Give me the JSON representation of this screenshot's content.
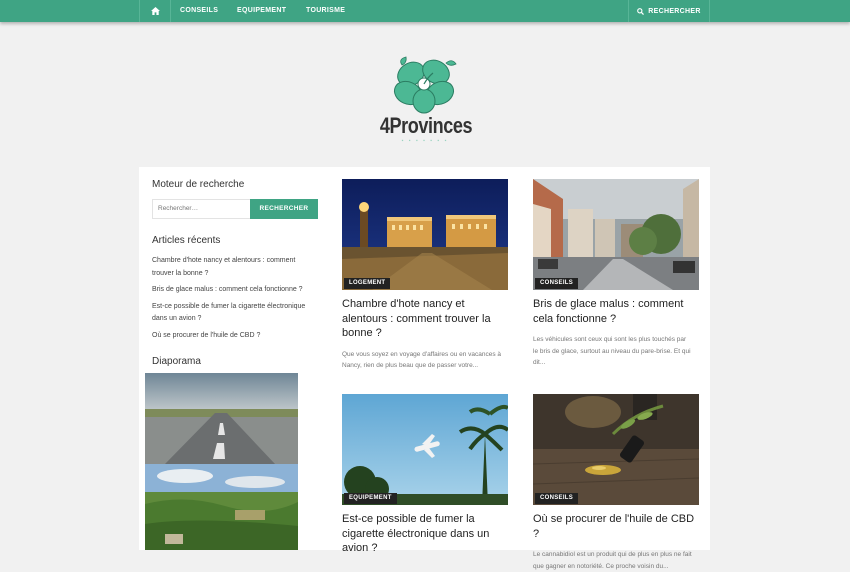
{
  "nav": {
    "home_icon": "home-icon",
    "items": [
      "CONSEILS",
      "EQUIPEMENT",
      "TOURISME"
    ],
    "search_label": "RECHERCHER",
    "search_icon": "search-icon",
    "accent": "#3fa484"
  },
  "logo": {
    "name": "4Provinces",
    "icon": "hibiscus-flower-logo"
  },
  "sidebar": {
    "search_title": "Moteur de recherche",
    "search_placeholder": "Rechercher…",
    "search_button": "RECHERCHER",
    "recent_title": "Articles récents",
    "recent": [
      "Chambre d'hote nancy et alentours : comment trouver la bonne ?",
      "Bris de glace malus : comment cela fonctionne ?",
      "Est-ce possible de fumer la cigarette électronique dans un avion ?",
      "Où se procurer de l'huile de CBD ?"
    ],
    "diaporama_title": "Diaporama"
  },
  "articles": [
    {
      "category": "LOGEMENT",
      "title": "Chambre d'hote nancy et alentours : comment trouver la bonne ?",
      "excerpt": "Que vous soyez en voyage d'affaires ou en vacances à Nancy, rien de plus beau que de passer votre..."
    },
    {
      "category": "CONSEILS",
      "title": "Bris de glace malus : comment cela fonctionne ?",
      "excerpt": "Les véhicules sont ceux qui sont les plus touchés par le bris de glace, surtout au niveau du pare-brise. Et qui dit..."
    },
    {
      "category": "EQUIPEMENT",
      "title": "Est-ce possible de fumer la cigarette électronique dans un avion ?",
      "excerpt": ""
    },
    {
      "category": "CONSEILS",
      "title": "Où se procurer de l'huile de CBD ?",
      "excerpt": "Le cannabidiol est un produit qui de plus en plus ne fait que gagner en notoriété. Ce proche voisin du..."
    }
  ]
}
